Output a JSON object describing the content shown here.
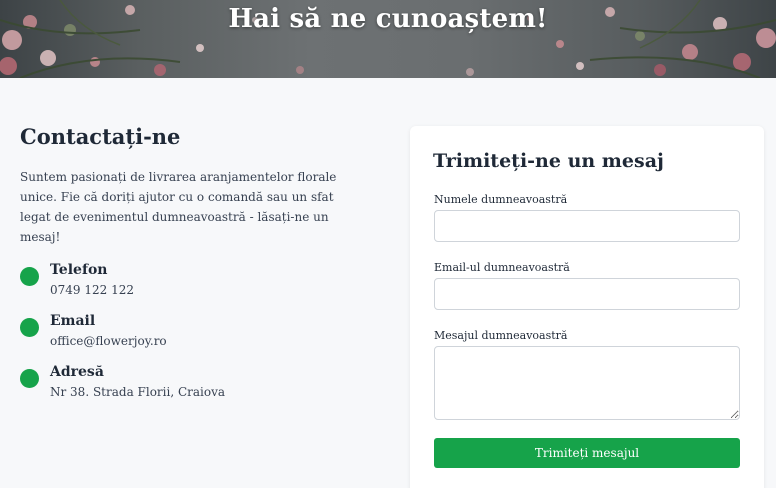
{
  "hero": {
    "title": "Hai să ne cunoaștem!"
  },
  "contact": {
    "heading": "Contactați-ne",
    "intro": "Suntem pasionați de livrarea aranjamentelor florale unice. Fie că doriți ajutor cu o comandă sau un sfat legat de evenimentul dumneavoastră - lăsați-ne un mesaj!",
    "items": [
      {
        "title": "Telefon",
        "value": "0749 122 122"
      },
      {
        "title": "Email",
        "value": "office@flowerjoy.ro"
      },
      {
        "title": "Adresă",
        "value": "Nr 38. Strada Florii, Craiova"
      }
    ]
  },
  "form": {
    "title": "Trimiteți-ne un mesaj",
    "name_label": "Numele dumneavoastră",
    "name_value": "",
    "email_label": "Email-ul dumneavoastră",
    "email_value": "",
    "message_label": "Mesajul dumneavoastră",
    "message_value": "",
    "submit_label": "Trimiteți mesajul"
  },
  "colors": {
    "accent": "#16a34a",
    "text": "#1f2937",
    "background": "#f7f8fa"
  }
}
